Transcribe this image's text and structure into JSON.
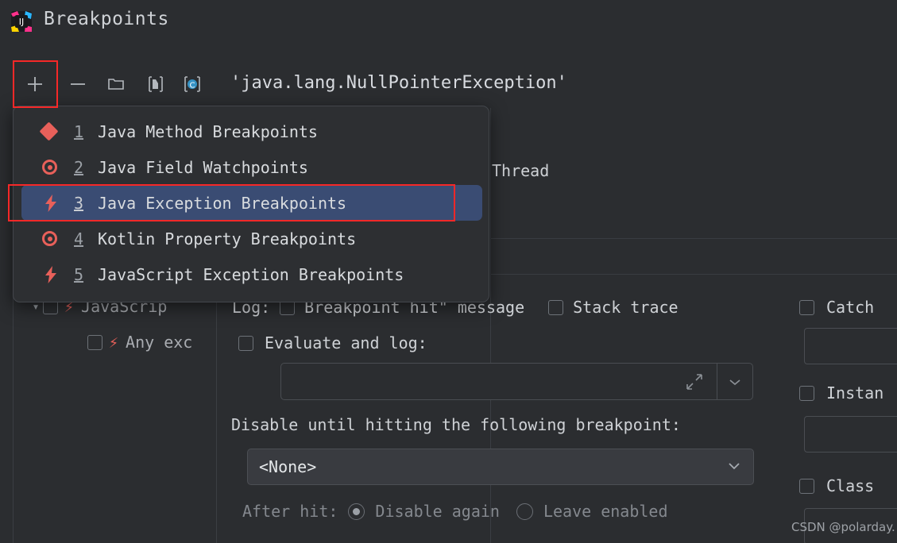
{
  "window": {
    "title": "Breakpoints",
    "app_icon": "intellij-idea-icon"
  },
  "toolbar": {
    "add_label": "+",
    "remove_label": "—",
    "group_icon": "folder-icon",
    "save_icon": "save-to-file-icon",
    "class_icon": "kotlin-class-icon",
    "breakpoint_title": "'java.lang.NullPointerException'"
  },
  "menu": {
    "items": [
      {
        "num": "1",
        "label": "Java Method Breakpoints",
        "icon": "diamond-icon",
        "selected": false
      },
      {
        "num": "2",
        "label": "Java Field Watchpoints",
        "icon": "eye-icon",
        "selected": false
      },
      {
        "num": "3",
        "label": "Java Exception Breakpoints",
        "icon": "bolt-icon",
        "selected": true
      },
      {
        "num": "4",
        "label": "Kotlin Property Breakpoints",
        "icon": "eye-icon",
        "selected": false
      },
      {
        "num": "5",
        "label": "JavaScript Exception Breakpoints",
        "icon": "bolt-icon",
        "selected": false
      }
    ]
  },
  "tree": {
    "items": [
      {
        "label": "JavaScrip",
        "icon": "bolt-icon",
        "checked": false,
        "expanded": true
      },
      {
        "label": "Any exc",
        "icon": "bolt-icon",
        "checked": false
      }
    ]
  },
  "details": {
    "thread_label": "Thread",
    "log_label": "Log:",
    "breakpoint_hit_label": "Breakpoint hit\" message",
    "stack_trace_label": "Stack trace",
    "evaluate_and_log_label": "Evaluate and log:",
    "evaluate_value": "",
    "expand_icon": "expand-icon",
    "chevron_icon": "chevron-down-icon",
    "disable_until_label": "Disable until hitting the following breakpoint:",
    "breakpoint_select_value": "<None>",
    "after_hit_label": "After hit:",
    "disable_again_label": "Disable again",
    "leave_enabled_label": "Leave enabled",
    "catch_label": "Catch",
    "catch_value": "",
    "instance_label": "Instan",
    "instance_value": "",
    "class_label": "Class",
    "class_value": ""
  },
  "watermark": {
    "text": "CSDN @polarday."
  },
  "colors": {
    "background": "#2b2d30",
    "menu_background": "#2d2f32",
    "selection_blue": "#3a4c73",
    "highlight_red": "#f62828",
    "icon_red": "#e8605a",
    "text_primary": "#d9dcdf",
    "text_dim": "#84888e"
  }
}
